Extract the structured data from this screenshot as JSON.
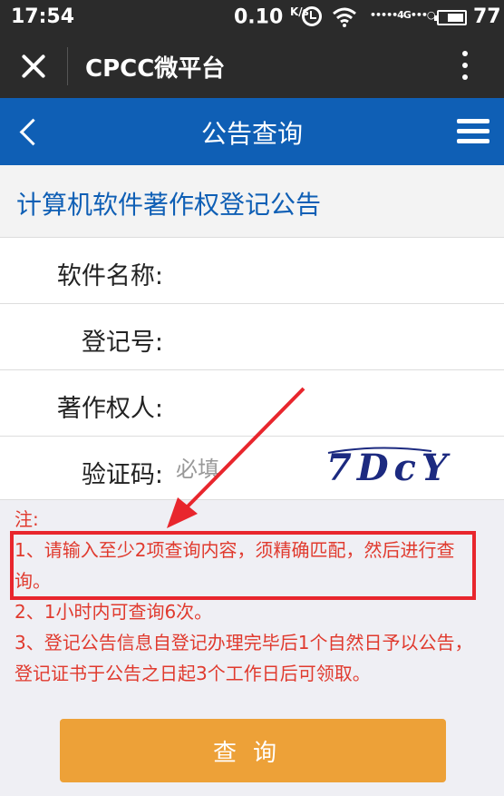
{
  "status_bar": {
    "time": "17:54",
    "speed": "0.10",
    "speed_unit": "K/s",
    "signal": "•••••4G•••○",
    "battery": "77"
  },
  "wechat_bar": {
    "title": "CPCC微平台"
  },
  "nav": {
    "title": "公告查询"
  },
  "page": {
    "section_title": "计算机软件著作权登记公告"
  },
  "form": {
    "software_name_label": "软件名称:",
    "reg_no_label": "登记号:",
    "owner_label": "著作权人:",
    "captcha_label": "验证码:",
    "captcha_placeholder": "必填",
    "captcha_text": "7DcY"
  },
  "notes": {
    "title": "注:",
    "line1": "1、请输入至少2项查询内容，须精确匹配，然后进行查询。",
    "line2": "2、1小时内可查询6次。",
    "line3": "3、登记公告信息自登记办理完毕后1个自然日予以公告，登记证书于公告之日起3个工作日后可领取。"
  },
  "buttons": {
    "query": "查询"
  },
  "colors": {
    "nav_blue": "#0f5fb5",
    "note_red": "#e03a2e",
    "button_orange": "#eda138",
    "annotation_red": "#e8262d"
  }
}
